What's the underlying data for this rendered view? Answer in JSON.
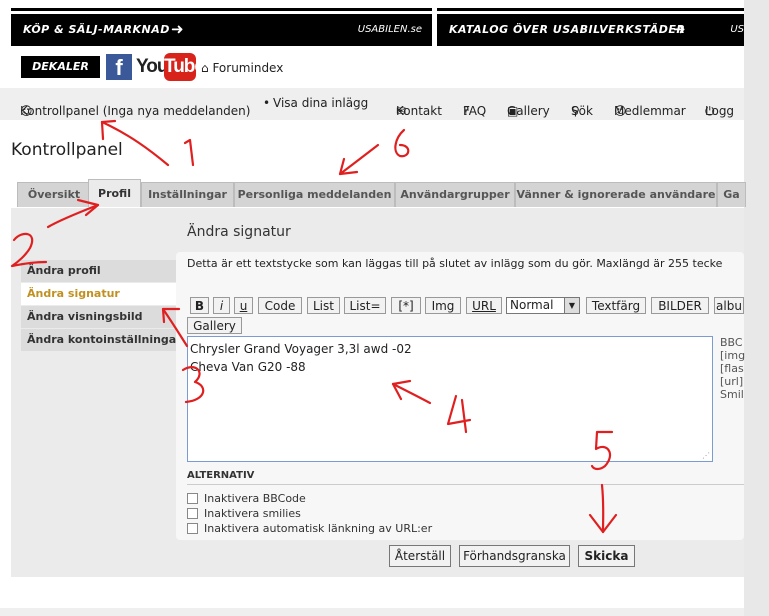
{
  "banners": {
    "left_title": "KÖP & SÄLJ-MARKNAD",
    "left_site": "USABILEN.se",
    "right_title": "KATALOG ÖVER USABILVERKSTÄDER",
    "right_site": "US",
    "arrow": "➜"
  },
  "links": {
    "dekaler": "DEKALER",
    "facebook": "f",
    "youtube_you": "You",
    "youtube_tube": "Tube",
    "forumindex": "Forumindex"
  },
  "nav": {
    "kontrollpanel": "Kontrollpanel (Inga nya meddelanden)",
    "sep": "•",
    "visa": "Visa dina inlägg",
    "kontakt": "Kontakt",
    "faq": "FAQ",
    "gallery": "Gallery",
    "sok": "Sök",
    "medlemmar": "Medlemmar",
    "logga": "Logg"
  },
  "page_title": "Kontrollpanel",
  "tabs": [
    "Översikt",
    "Profil",
    "Inställningar",
    "Personliga meddelanden",
    "Användargrupper",
    "Vänner & ignorerade användare",
    "Ga"
  ],
  "active_tab": "Profil",
  "sidebar": {
    "items": [
      "Ändra profil",
      "Ändra signatur",
      "Ändra visningsbild",
      "Ändra kontoinställningar"
    ],
    "active": "Ändra signatur"
  },
  "main": {
    "heading": "Ändra signatur",
    "description": "Detta är ett textstycke som kan läggas till på slutet av inlägg som du gör. Maxlängd är 255 tecke",
    "toolbar": {
      "bold": "B",
      "italic": "i",
      "underline": "u",
      "code": "Code",
      "list": "List",
      "list_eq": "List=",
      "star": "[*]",
      "img": "Img",
      "url": "URL",
      "size_selected": "Normal",
      "textfarg": "Textfärg",
      "bilder": "BILDER",
      "album": "albu",
      "gallery": "Gallery"
    },
    "signature_lines": [
      "Chrysler Grand Voyager 3,3l awd -02",
      "Cheva Van G20 -88"
    ],
    "bbcode_help": [
      "BBC",
      "[img",
      "[flas",
      "[url]",
      "Smil"
    ],
    "options_title": "ALTERNATIV",
    "options": [
      "Inaktivera BBCode",
      "Inaktivera smilies",
      "Inaktivera automatisk länkning av URL:er"
    ],
    "buttons": {
      "reset": "Återställ",
      "preview": "Förhandsgranska",
      "submit": "Skicka"
    }
  },
  "annotations": [
    "1",
    "2",
    "3",
    "4",
    "5",
    "6"
  ],
  "colors": {
    "active_side_text": "#c09020",
    "annotation_red": "#e02020",
    "banner_bg": "#000000"
  }
}
